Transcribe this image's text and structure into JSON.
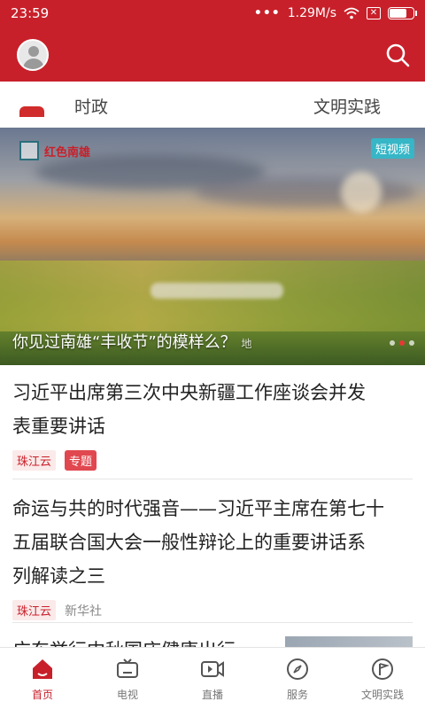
{
  "status_bar": {
    "time": "23:59",
    "network_speed": "1.29M/s",
    "icons": [
      "signal-dots-icon",
      "wifi-icon",
      "sim-x-icon",
      "battery-icon"
    ]
  },
  "header": {
    "avatar": "avatar-icon",
    "search": "search-icon"
  },
  "tabs": [
    {
      "label": "时政"
    },
    {
      "label": "文明实践"
    }
  ],
  "hero": {
    "logo_text": "红色南雄",
    "badge": "短视频",
    "caption": "你见过南雄“丰收节”的模样么？",
    "caption_suffix": "地",
    "dots_count": 3,
    "active_dot": 2
  },
  "news": [
    {
      "title_line1": "习近平出席第三次中央新疆工作座谈会并发",
      "title_line2": "表重要讲话",
      "source": "珠江云",
      "topic_tag": "专题"
    },
    {
      "title_line1": "命运与共的时代强音——习近平主席在第七十",
      "title_line2": "五届联合国大会一般性辩论上的重要讲话系",
      "title_line3": "列解读之三",
      "source": "珠江云",
      "publisher": "新华社"
    },
    {
      "title_partial": "广东举行中秋国庆健康出行"
    }
  ],
  "bottom_nav": [
    {
      "label": "首页",
      "icon": "home-icon",
      "active": true
    },
    {
      "label": "电视",
      "icon": "tv-icon",
      "active": false
    },
    {
      "label": "直播",
      "icon": "live-icon",
      "active": false
    },
    {
      "label": "服务",
      "icon": "compass-icon",
      "active": false
    },
    {
      "label": "文明实践",
      "icon": "flag-icon",
      "active": false
    }
  ],
  "colors": {
    "brand_red": "#c8202a",
    "badge_teal": "#36b6c6",
    "inactive_text": "#777777"
  }
}
